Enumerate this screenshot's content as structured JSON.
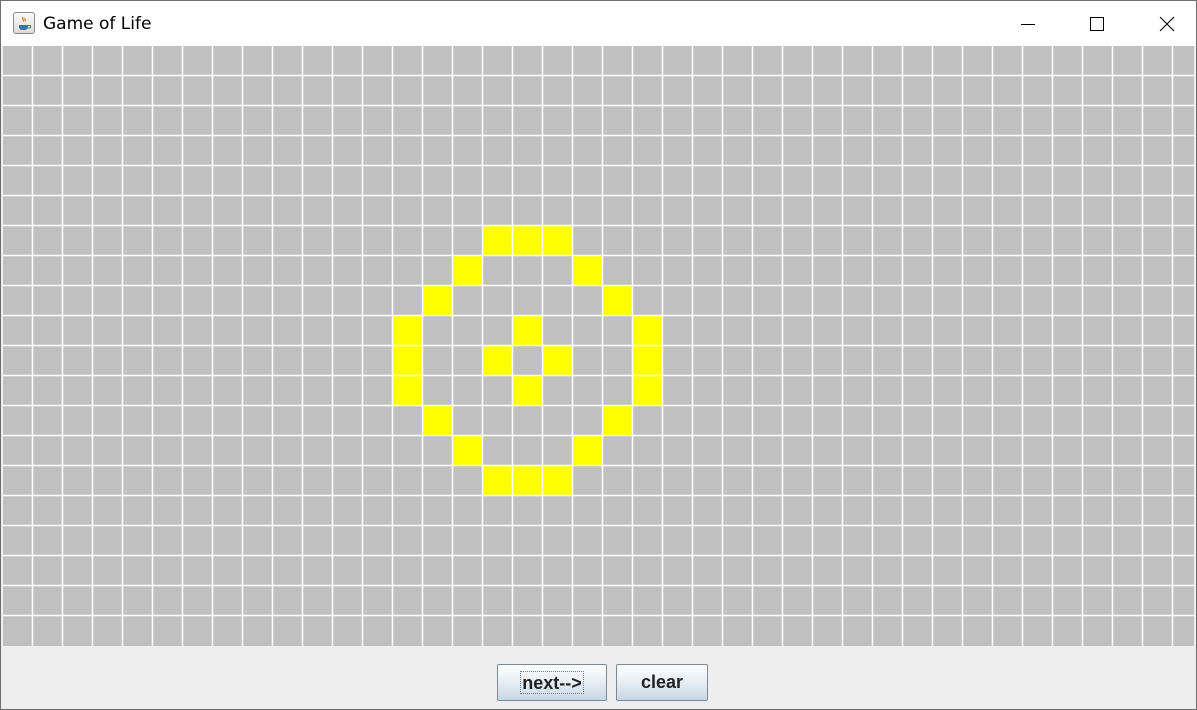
{
  "window": {
    "title": "Game of Life",
    "controls": [
      "minimize",
      "maximize",
      "close"
    ]
  },
  "board": {
    "rows": 20,
    "cols": 40,
    "dead_color": "#c0c0c0",
    "live_color": "#ffff00",
    "grid_color": "#ffffff",
    "live_cells": [
      [
        6,
        16
      ],
      [
        6,
        17
      ],
      [
        6,
        18
      ],
      [
        7,
        15
      ],
      [
        7,
        19
      ],
      [
        8,
        14
      ],
      [
        8,
        20
      ],
      [
        9,
        13
      ],
      [
        9,
        17
      ],
      [
        9,
        21
      ],
      [
        10,
        13
      ],
      [
        10,
        16
      ],
      [
        10,
        18
      ],
      [
        10,
        21
      ],
      [
        11,
        13
      ],
      [
        11,
        17
      ],
      [
        11,
        21
      ],
      [
        12,
        14
      ],
      [
        12,
        20
      ],
      [
        13,
        15
      ],
      [
        13,
        19
      ],
      [
        14,
        16
      ],
      [
        14,
        17
      ],
      [
        14,
        18
      ]
    ]
  },
  "buttons": {
    "next_label": "next-->",
    "clear_label": "clear"
  }
}
